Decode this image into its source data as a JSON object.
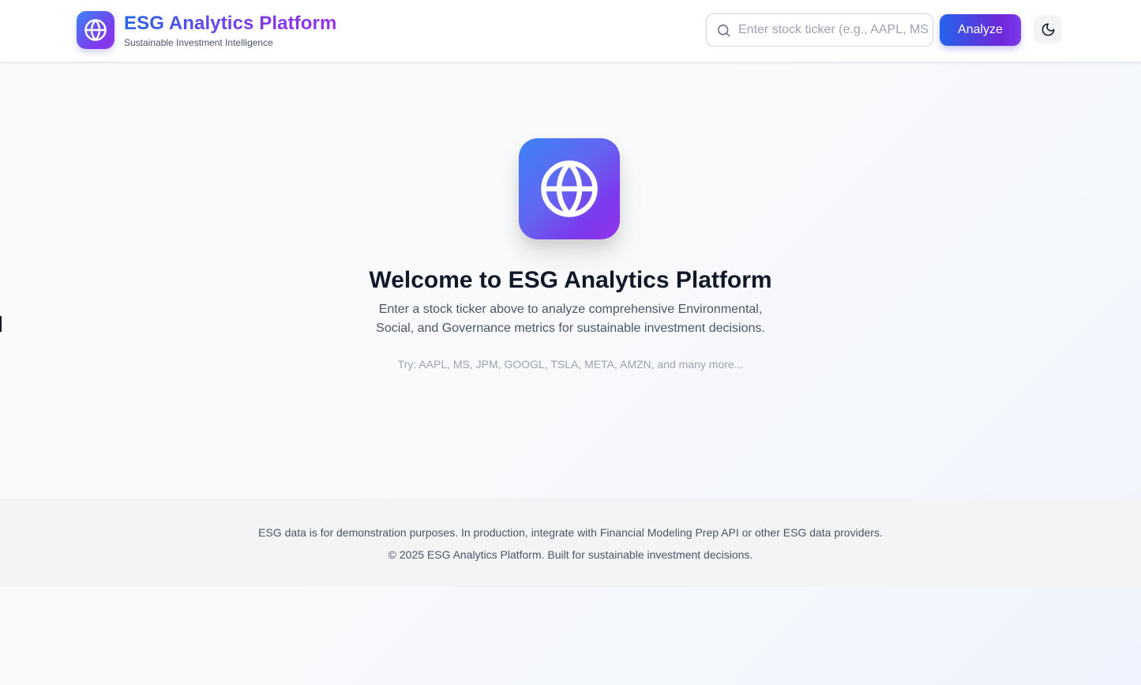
{
  "header": {
    "title": "ESG Analytics Platform",
    "subtitle": "Sustainable Investment Intelligence",
    "logo_icon": "globe-icon",
    "search": {
      "icon": "search-icon",
      "placeholder": "Enter stock ticker (e.g., AAPL, MS",
      "value": ""
    },
    "analyze_label": "Analyze",
    "theme_toggle_icon": "moon-icon"
  },
  "hero": {
    "icon": "globe-icon",
    "title": "Welcome to ESG Analytics Platform",
    "description": "Enter a stock ticker above to analyze comprehensive Environmental, Social, and Governance metrics for sustainable investment decisions.",
    "hint": "Try: AAPL, MS, JPM, GOOGL, TSLA, META, AMZN, and many more..."
  },
  "footer": {
    "disclaimer": "ESG data is for demonstration purposes. In production, integrate with Financial Modeling Prep API or other ESG data providers.",
    "copyright": "© 2025 ESG Analytics Platform. Built for sustainable investment decisions."
  },
  "colors": {
    "accent_blue": "#2563eb",
    "accent_purple": "#7c3aed",
    "text_dark": "#111827",
    "text_muted": "#4b5563",
    "text_hint": "#9ca3af",
    "footer_bg": "#f3f4f6"
  }
}
